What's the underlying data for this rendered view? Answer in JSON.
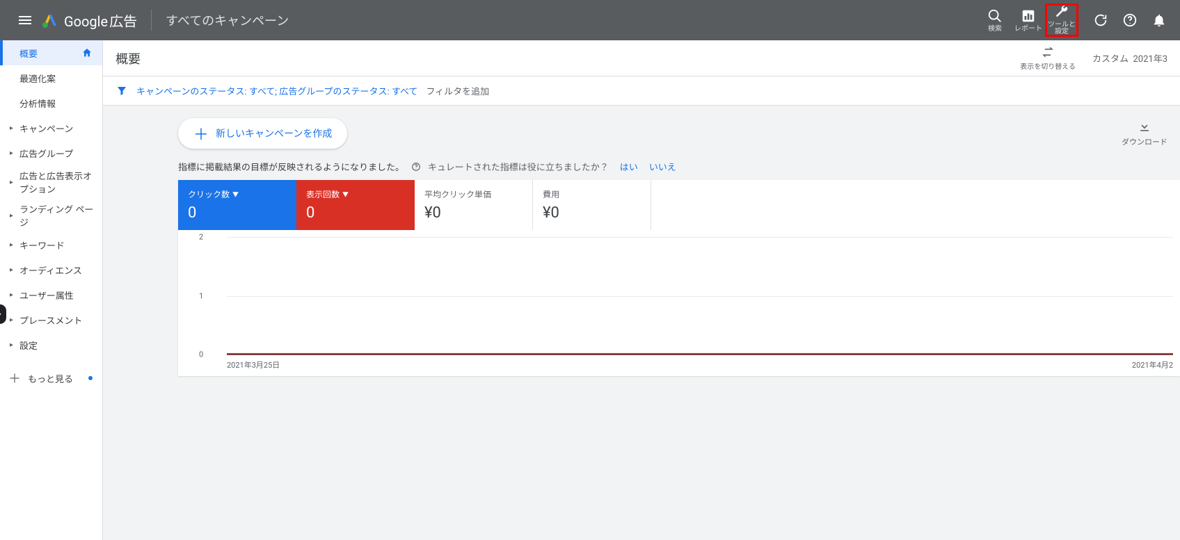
{
  "header": {
    "product": "Google",
    "product_suffix": "広告",
    "scope": "すべてのキャンペーン",
    "actions": {
      "search": "検索",
      "reports": "レポート",
      "tools": "ツールと設定"
    }
  },
  "sidebar": {
    "overview": "概要",
    "recommendations": "最適化案",
    "insights": "分析情報",
    "campaigns": "キャンペーン",
    "adgroups": "広告グループ",
    "ads_ext": "広告と広告表示オプション",
    "landing": "ランディング ページ",
    "keywords": "キーワード",
    "audiences": "オーディエンス",
    "demographics": "ユーザー属性",
    "placements": "プレースメント",
    "settings": "設定",
    "more": "もっと見る"
  },
  "page": {
    "title": "概要",
    "switch_view": "表示を切り替える",
    "date_range_prefix": "カスタム",
    "date_range": "2021年3",
    "filter_chip": "キャンペーンのステータス: すべて; 広告グループのステータス: すべて",
    "add_filter": "フィルタを追加",
    "new_campaign": "新しいキャンペーンを作成",
    "download": "ダウンロード",
    "info_text": "指標に掲載結果の目標が反映されるようになりました。",
    "curated_q": "キュレートされた指標は役に立ちましたか？",
    "yes": "はい",
    "no": "いいえ"
  },
  "cards": [
    {
      "label": "クリック数",
      "value": "0",
      "style": "blue",
      "dropdown": true
    },
    {
      "label": "表示回数",
      "value": "0",
      "style": "red",
      "dropdown": true
    },
    {
      "label": "平均クリック単価",
      "value": "¥0",
      "style": "white",
      "dropdown": false
    },
    {
      "label": "費用",
      "value": "¥0",
      "style": "white",
      "dropdown": false
    }
  ],
  "chart_data": {
    "type": "line",
    "x": [
      "2021年3月25日",
      "2021年4月2"
    ],
    "series": [
      {
        "name": "クリック数",
        "color": "#1a73e8",
        "values": [
          0,
          0
        ]
      },
      {
        "name": "表示回数",
        "color": "#d93025",
        "values": [
          0,
          0
        ]
      }
    ],
    "y_ticks": [
      0,
      1,
      2
    ],
    "ylim": [
      0,
      2
    ]
  }
}
